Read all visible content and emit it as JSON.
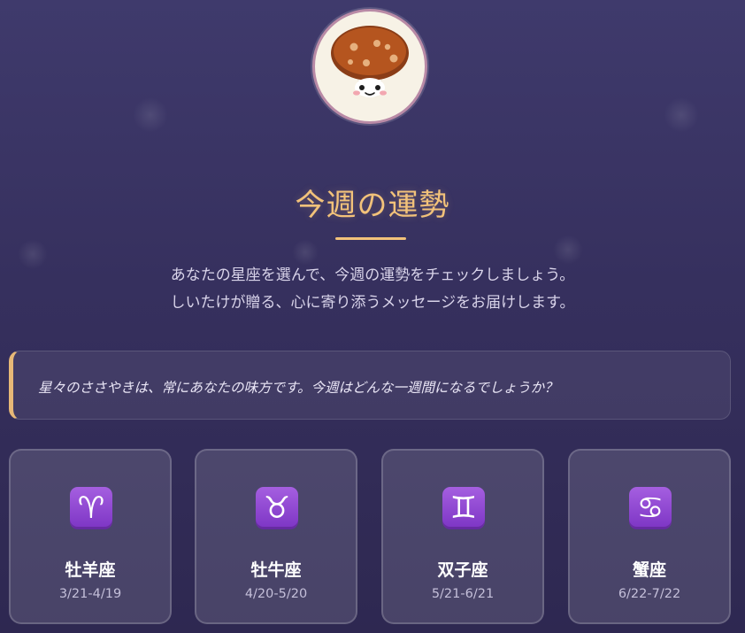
{
  "page": {
    "title": "今週の運勢",
    "intro_lines": [
      "あなたの星座を選んで、今週の運勢をチェックしましょう。",
      "しいたけが贈る、心に寄り添うメッセージをお届けします。"
    ],
    "quote": "星々のささやきは、常にあなたの味方です。今週はどんな一週間になるでしょうか？"
  },
  "zodiac": [
    {
      "symbol": "♈",
      "icon": "aries-icon",
      "name": "牡羊座",
      "dates": "3/21-4/19"
    },
    {
      "symbol": "♉",
      "icon": "taurus-icon",
      "name": "牡牛座",
      "dates": "4/20-5/20"
    },
    {
      "symbol": "♊",
      "icon": "gemini-icon",
      "name": "双子座",
      "dates": "5/21-6/21"
    },
    {
      "symbol": "♋",
      "icon": "cancer-icon",
      "name": "蟹座",
      "dates": "6/22-7/22"
    }
  ],
  "colors": {
    "accent": "#f2c27a",
    "sign_purple": "#8e44d6",
    "background": "#3a3466"
  },
  "mascot": {
    "icon": "shiitake-mushroom-icon"
  }
}
